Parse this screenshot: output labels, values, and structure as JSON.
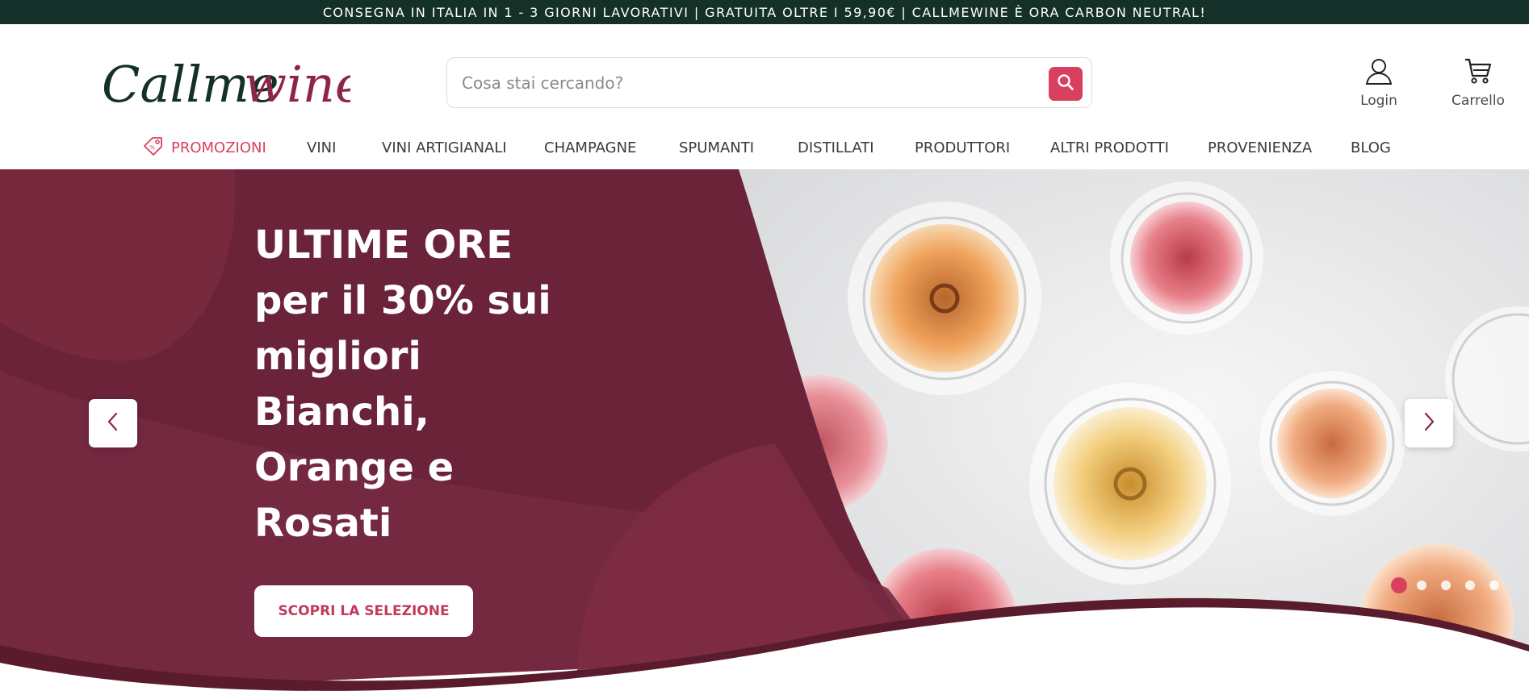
{
  "topbar": {
    "text": "CONSEGNA IN ITALIA IN 1 - 3 GIORNI LAVORATIVI | GRATUITA OLTRE I 59,90€ | CALLMEWINE È ORA CARBON NEUTRAL!"
  },
  "logo": {
    "part1": "Callme",
    "part2": "wine"
  },
  "search": {
    "placeholder": "Cosa stai cercando?",
    "icon": "search-icon"
  },
  "header_actions": {
    "login_label": "Login",
    "cart_label": "Carrello"
  },
  "nav": {
    "items": [
      {
        "label": "PROMOZIONI",
        "icon": "tag-icon"
      },
      {
        "label": "VINI"
      },
      {
        "label": "VINI ARTIGIANALI"
      },
      {
        "label": "CHAMPAGNE"
      },
      {
        "label": "SPUMANTI"
      },
      {
        "label": "DISTILLATI"
      },
      {
        "label": "PRODUTTORI"
      },
      {
        "label": "ALTRI PRODOTTI"
      },
      {
        "label": "PROVENIENZA"
      },
      {
        "label": "BLOG"
      }
    ]
  },
  "hero": {
    "title_lines": [
      "ULTIME ORE",
      "per il 30% sui",
      "migliori",
      "Bianchi,",
      "Orange e",
      "Rosati"
    ],
    "cta_label": "SCOPRI LA SELEZIONE",
    "slides_total": 5,
    "active_slide": 1
  },
  "colors": {
    "topbar_bg": "#143028",
    "accent": "#d9405f",
    "hero_bg": "#6a2338",
    "logo_dark": "#143028",
    "logo_wine": "#8e2446"
  }
}
